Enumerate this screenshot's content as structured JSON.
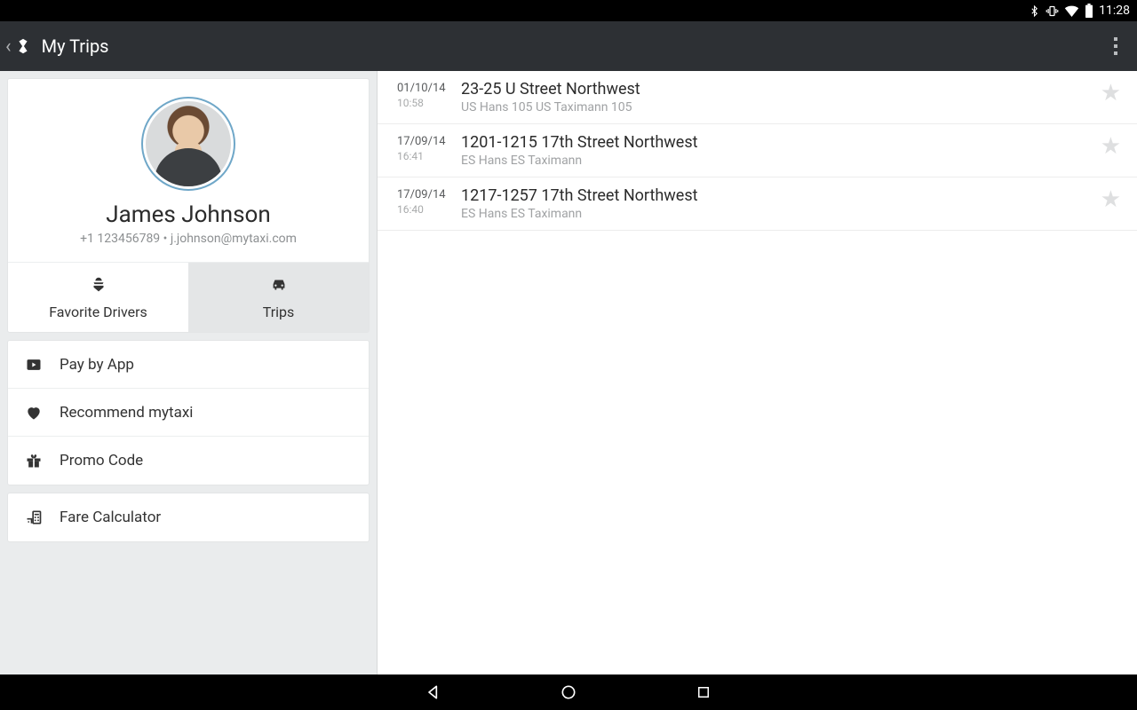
{
  "status": {
    "time": "11:28"
  },
  "appbar": {
    "title": "My Trips"
  },
  "profile": {
    "name": "James Johnson",
    "subtitle": "+1 123456789 • j.johnson@mytaxi.com"
  },
  "tabs": {
    "favorite": "Favorite Drivers",
    "trips": "Trips"
  },
  "menu": {
    "pay": "Pay by App",
    "recommend": "Recommend mytaxi",
    "promo": "Promo Code",
    "calc": "Fare Calculator"
  },
  "trips": [
    {
      "date": "01/10/14",
      "time": "10:58",
      "address": "23-25 U Street Northwest",
      "driver": "US Hans 105 US Taximann 105"
    },
    {
      "date": "17/09/14",
      "time": "16:41",
      "address": "1201-1215 17th Street Northwest",
      "driver": "ES Hans ES Taximann"
    },
    {
      "date": "17/09/14",
      "time": "16:40",
      "address": "1217-1257 17th Street Northwest",
      "driver": "ES Hans ES Taximann"
    }
  ]
}
